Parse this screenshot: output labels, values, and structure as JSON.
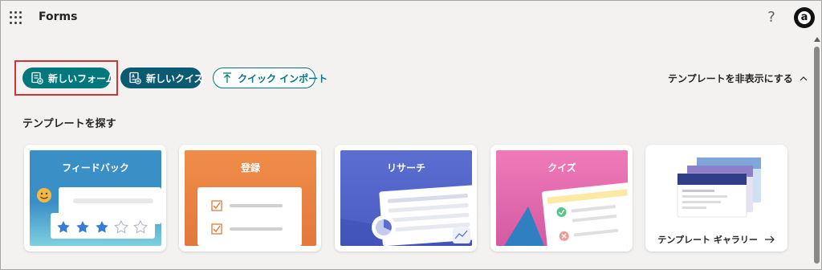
{
  "app": {
    "title": "Forms",
    "help_label": "?",
    "avatar_letter": "a"
  },
  "actions": {
    "new_form": "新しいフォーム",
    "new_quiz": "新しいクイズ",
    "quick_import": "クイック インポート",
    "hide_templates": "テンプレートを非表示にする"
  },
  "templates": {
    "section_title": "テンプレートを探す",
    "cards": [
      {
        "title": "フィードバック",
        "color": "#3a8fc7",
        "stars_filled": 3,
        "stars_total": 5
      },
      {
        "title": "登録",
        "color": "#f08c4a"
      },
      {
        "title": "リサーチ",
        "color": "#5b6ed0"
      },
      {
        "title": "クイズ",
        "color": "#f07ab9"
      },
      {
        "title": "テンプレート ギャラリー"
      }
    ]
  },
  "colors": {
    "accent": "#03787c",
    "quiz_button": "#0b5a72",
    "highlight": "#d13438",
    "background": "#f3f2f1"
  }
}
